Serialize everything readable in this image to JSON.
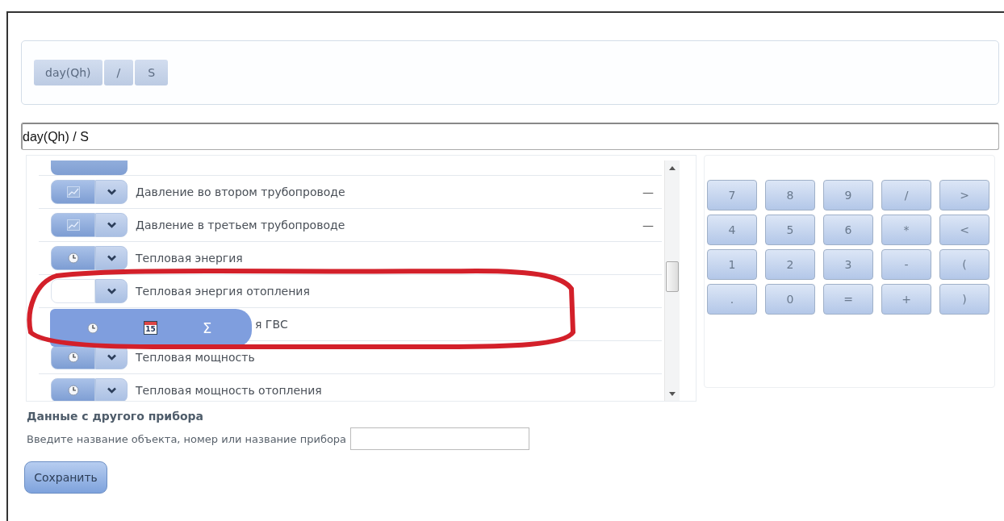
{
  "tokens": [
    {
      "label": "day(Qh)"
    },
    {
      "label": "/"
    },
    {
      "label": "S"
    }
  ],
  "formula": {
    "value": "day(Qh) / S"
  },
  "parameters": [
    {
      "label": "Давление во втором трубопроводе",
      "kind": "chart",
      "value": "—",
      "covered": false
    },
    {
      "label": "Давление в третьем трубопроводе",
      "kind": "chart",
      "value": "—",
      "covered": false
    },
    {
      "label": "Тепловая энергия",
      "kind": "clock",
      "covered": false
    },
    {
      "label": "Тепловая энергия отопления",
      "kind": "empty",
      "covered": false
    },
    {
      "label": "я ГВС",
      "covered": true
    },
    {
      "label": "Тепловая мощность",
      "kind": "clock",
      "covered": false
    },
    {
      "label": "Тепловая мощность отопления",
      "kind": "clock",
      "covered": false
    }
  ],
  "popup_menu": [
    {
      "kind": "clock"
    },
    {
      "kind": "calendar",
      "text": "15"
    },
    {
      "kind": "sum",
      "text": "Σ"
    }
  ],
  "keypad": [
    "7",
    "8",
    "9",
    "/",
    ">",
    "4",
    "5",
    "6",
    "*",
    "<",
    "1",
    "2",
    "3",
    "-",
    "(",
    ".",
    "0",
    "=",
    "+",
    ")"
  ],
  "other_device": {
    "heading": "Данные с другого прибора",
    "prompt": "Введите название объекта, номер или название прибора"
  },
  "save_button": "Сохранить"
}
